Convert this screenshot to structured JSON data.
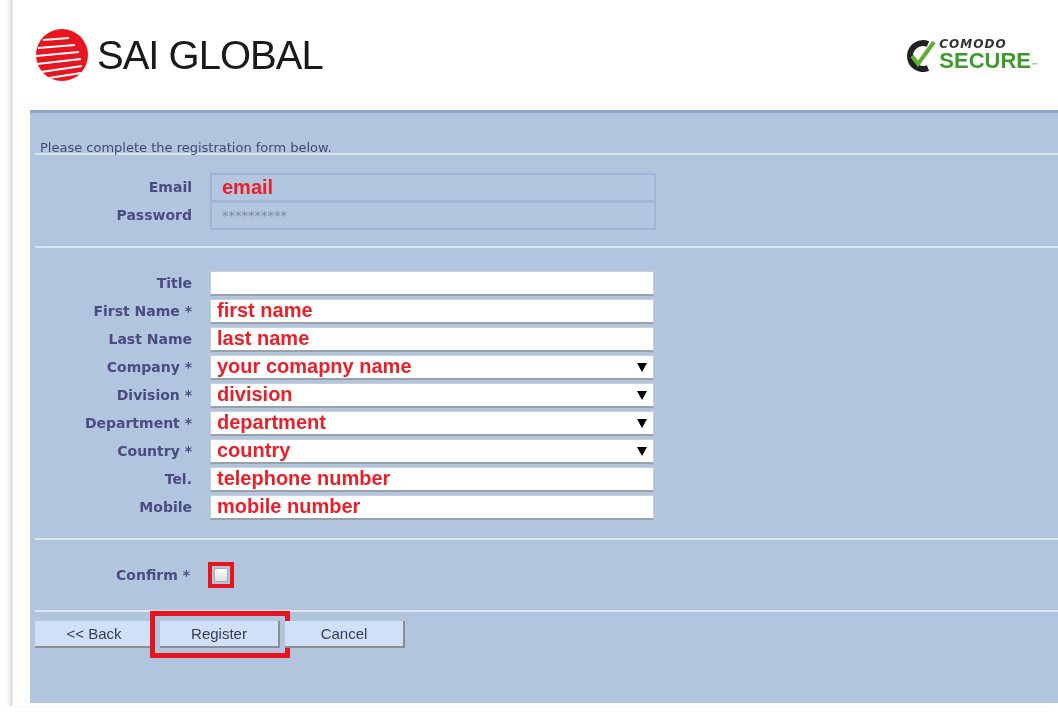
{
  "header": {
    "brand": "SAI GLOBAL",
    "badge_top": "COMODO",
    "badge_bottom": "SECURE",
    "badge_mark": "™"
  },
  "intro": "Please complete the registration form below.",
  "login_fields": [
    {
      "label": "Email",
      "value": "email",
      "kind": "readonly"
    },
    {
      "label": "Password",
      "value": "**********",
      "kind": "password"
    }
  ],
  "profile_fields": [
    {
      "label": "Title",
      "kind": "text"
    },
    {
      "label": "First Name *",
      "value": "first name",
      "kind": "text"
    },
    {
      "label": "Last Name",
      "value": "last name",
      "kind": "text"
    },
    {
      "label": "Company *",
      "value": "your comapny name",
      "kind": "select"
    },
    {
      "label": "Division *",
      "value": "division",
      "kind": "select"
    },
    {
      "label": "Department *",
      "value": "department",
      "kind": "select"
    },
    {
      "label": "Country *",
      "value": "country",
      "kind": "select"
    },
    {
      "label": "Tel.",
      "value": "telephone number",
      "kind": "text"
    },
    {
      "label": "Mobile",
      "value": "mobile number",
      "kind": "text"
    }
  ],
  "confirm": {
    "label": "Confirm *",
    "checked": false,
    "highlighted": true
  },
  "buttons": [
    {
      "label": "<< Back",
      "highlighted": false
    },
    {
      "label": "Register",
      "highlighted": true
    },
    {
      "label": "Cancel",
      "highlighted": false
    }
  ]
}
